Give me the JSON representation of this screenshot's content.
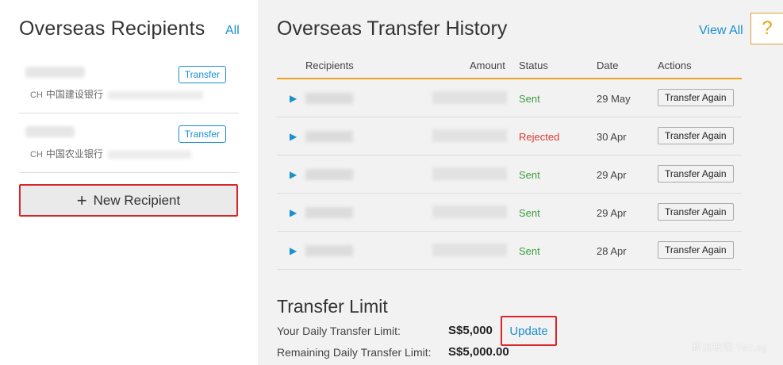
{
  "recipients_panel": {
    "title": "Overseas Recipients",
    "all_link": "All",
    "items": [
      {
        "country": "CH",
        "bank": "中国建设银行",
        "transfer_label": "Transfer"
      },
      {
        "country": "CH",
        "bank": "中国农业银行",
        "transfer_label": "Transfer"
      }
    ],
    "new_recipient_label": "New Recipient"
  },
  "history": {
    "title": "Overseas Transfer History",
    "view_all": "View All",
    "help_icon": "?",
    "columns": [
      "Recipients",
      "Amount",
      "Status",
      "Date",
      "Actions"
    ],
    "rows": [
      {
        "status": "Sent",
        "date": "29 May",
        "action": "Transfer Again"
      },
      {
        "status": "Rejected",
        "date": "30 Apr",
        "action": "Transfer Again"
      },
      {
        "status": "Sent",
        "date": "29 Apr",
        "action": "Transfer Again"
      },
      {
        "status": "Sent",
        "date": "29 Apr",
        "action": "Transfer Again"
      },
      {
        "status": "Sent",
        "date": "28 Apr",
        "action": "Transfer Again"
      }
    ]
  },
  "limit": {
    "title": "Transfer Limit",
    "daily_label": "Your Daily Transfer Limit:",
    "daily_value": "S$5,000",
    "update_label": "Update",
    "remaining_label": "Remaining Daily Transfer Limit:",
    "remaining_value": "S$5,000.00"
  },
  "watermark": "新加坡眼 Yan.sg",
  "colors": {
    "accent": "#1a8fd0",
    "highlight_border": "#d9262b",
    "table_rule": "#f0a020",
    "sent": "#3a9d3a",
    "rejected": "#d93a35"
  }
}
